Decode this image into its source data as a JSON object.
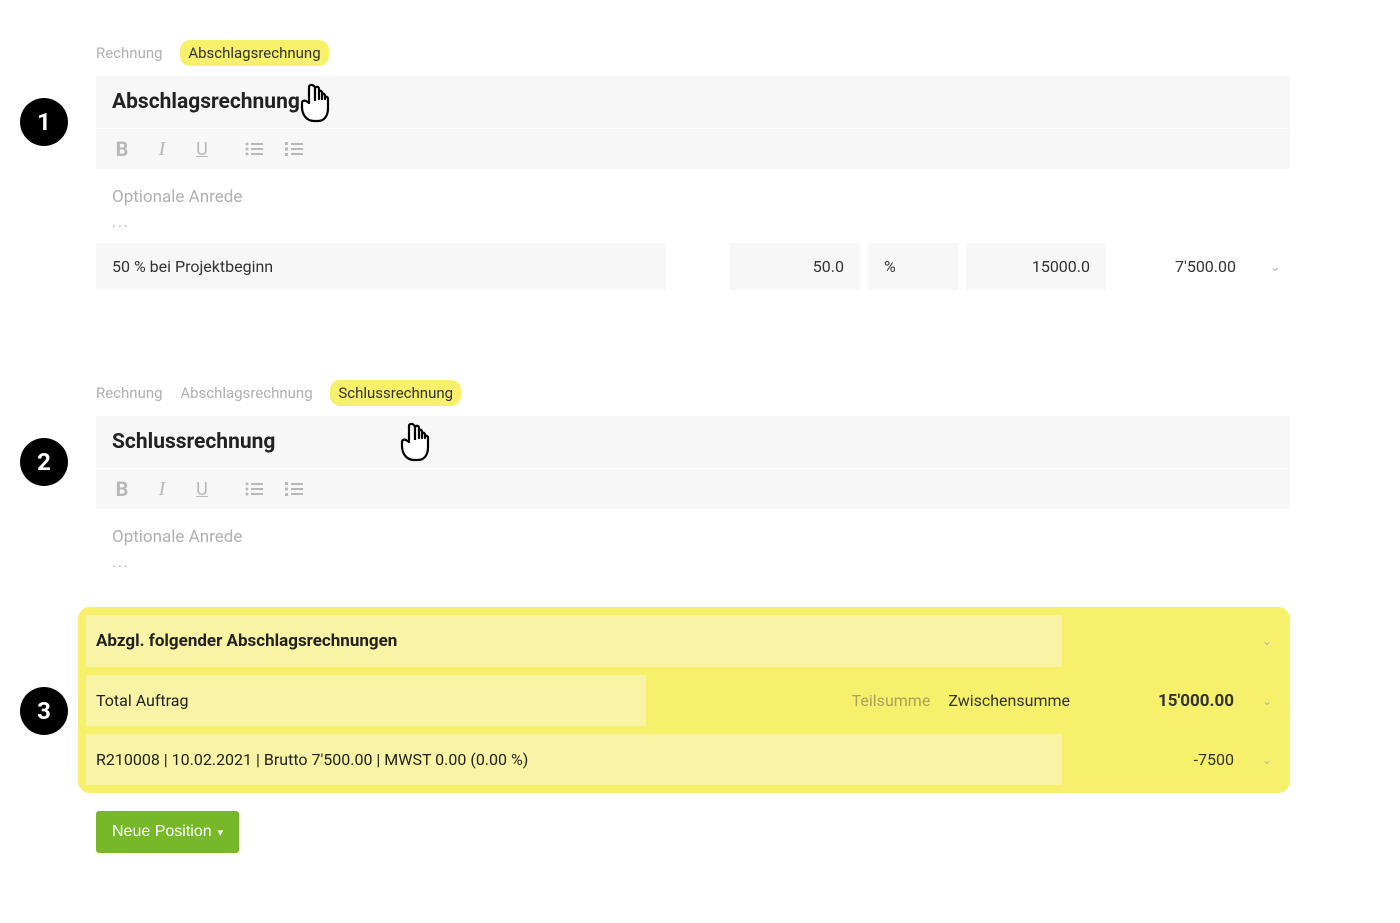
{
  "section1": {
    "breadcrumb": {
      "item1": "Rechnung",
      "item2": "Abschlagsrechnung"
    },
    "title": "Abschlagsrechnung",
    "salutation_placeholder": "Optionale Anrede",
    "ellipsis": "...",
    "line_item": {
      "description": "50 % bei Projektbeginn",
      "quantity": "50.0",
      "unit": "%",
      "price": "15000.0",
      "total": "7'500.00"
    }
  },
  "section2": {
    "breadcrumb": {
      "item1": "Rechnung",
      "item2": "Abschlagsrechnung",
      "item3": "Schlussrechnung"
    },
    "title": "Schlussrechnung",
    "salutation_placeholder": "Optionale Anrede",
    "ellipsis": "..."
  },
  "section3": {
    "header": "Abzgl. folgender Abschlagsrechnungen",
    "total_label": "Total Auftrag",
    "subtotal_muted": "Teilsumme",
    "subtotal_label": "Zwischensumme",
    "subtotal_value": "15'000.00",
    "deduction_line": "R210008 | 10.02.2021 | Brutto 7'500.00 | MWST 0.00 (0.00 %)",
    "deduction_value": "-7500"
  },
  "new_position_label": "Neue Position",
  "badges": {
    "b1": "1",
    "b2": "2",
    "b3": "3"
  },
  "toolbar_icons": {
    "bold": "B",
    "italic": "I",
    "underline": "U"
  }
}
